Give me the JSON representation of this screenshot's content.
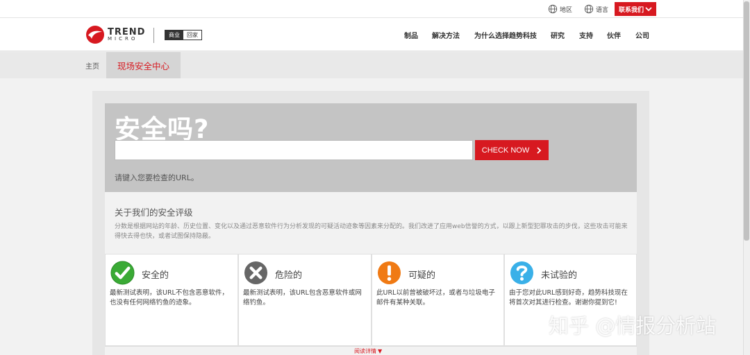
{
  "utility_bar": {
    "region_label": "地区",
    "language_label": "语言",
    "contact_label": "联系我们"
  },
  "header": {
    "logo_top": "TREND",
    "logo_bottom": "MICRO",
    "segment_business": "商业",
    "segment_home": "回家",
    "nav": [
      "制品",
      "解决方法",
      "为什么选择趋势科技",
      "研究",
      "支持",
      "伙伴",
      "公司"
    ]
  },
  "breadcrumb": {
    "home": "主页",
    "current": "现场安全中心"
  },
  "checker": {
    "title": "安全吗?",
    "input_value": "",
    "button_label": "CHECK NOW",
    "hint": "请键入您要检查的URL。"
  },
  "ratings": {
    "title": "关于我们的安全评级",
    "description": "分数是根据网站的年龄、历史位置、变化以及通过恶意软件行为分析发现的可疑活动迹象等因素来分配的。我们改进了应用web信誉的方式，以跟上新型犯罪攻击的步伐，这些攻击可能来得快去得也快，或者试图保持隐蔽。",
    "categories": [
      {
        "label": "安全的",
        "text": "最新测试表明，该URL不包含恶意软件，也没有任何网络钓鱼的迹象。",
        "icon": "check-icon",
        "color": "#3aaa35"
      },
      {
        "label": "危险的",
        "text": "最新测试表明，该URL包含恶意软件或网络钓鱼。",
        "icon": "x-icon",
        "color": "#666666"
      },
      {
        "label": "可疑的",
        "text": "此URL以前曾被破坏过，或者与垃圾电子邮件有某种关联。",
        "icon": "exclamation-icon",
        "color": "#f07a14"
      },
      {
        "label": "未试验的",
        "text": "由于您对此URL感到好奇，趋势科技现在将首次对其进行检查。谢谢你提到它!",
        "icon": "question-icon",
        "color": "#3ab0e8"
      }
    ],
    "more_label": "阅读详情"
  },
  "watermark": "知乎 @情报分析站",
  "colors": {
    "brand_red": "#d71920"
  }
}
